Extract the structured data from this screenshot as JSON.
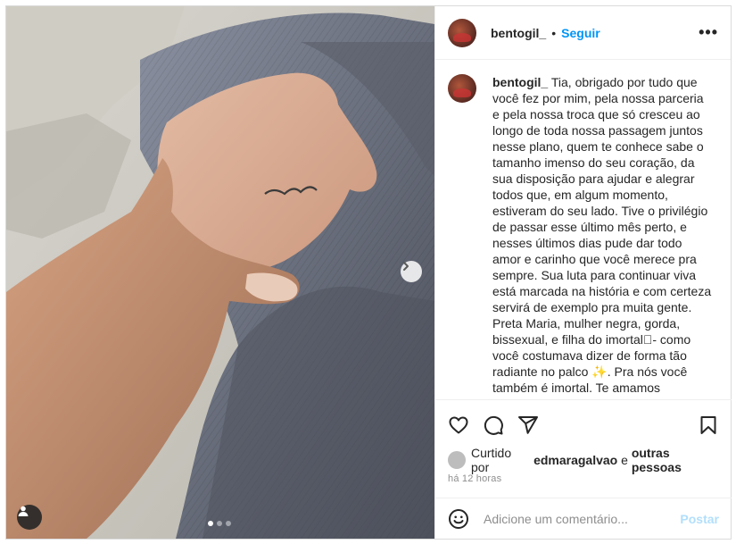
{
  "post": {
    "username": "bentogil_",
    "separator": "•",
    "follow_label": "Seguir",
    "more_label": "•••",
    "caption_before_emoji": "Tia, obrigado por tudo que você fez por mim, pela nossa parceria e pela nossa troca que só cresceu ao longo de toda nossa passagem juntos nesse plano, quem te conhece sabe o tamanho imenso do seu coração, da sua disposição para ajudar e alegrar todos que, em algum momento, estiveram do seu lado. Tive o privilégio de passar esse último mês perto, e nesses últimos dias pude dar todo amor e carinho que você merece pra sempre. Sua luta para continuar viva está marcada na história e com certeza servirá de exemplo pra muita gente. Preta Maria, mulher negra, gorda, bissexual, e filha do imortal⃝- como você costumava dizer de forma tão radiante no palco",
    "caption_emoji": "✨",
    "caption_after_emoji": ". Pra nós você também é imortal. Te amamos",
    "liked_by_prefix": "Curtido por",
    "liked_by_user": "edmaragalvao",
    "liked_by_joiner": "e",
    "liked_by_others": "outras pessoas",
    "timestamp": "há 12 horas",
    "comment_placeholder": "Adicione um comentário...",
    "post_button_label": "Postar"
  },
  "carousel": {
    "slide_count": 3,
    "active_slide": 1
  },
  "icons": {
    "like": "heart-icon",
    "comment": "comment-icon",
    "share": "paper-plane-icon",
    "save": "bookmark-icon",
    "emoji": "smiley-icon",
    "next": "chevron-right-icon",
    "tags": "user-tag-icon"
  },
  "colors": {
    "follow": "#0095f6",
    "post_disabled": "#b2dffc",
    "muted": "#8e8e8e"
  }
}
